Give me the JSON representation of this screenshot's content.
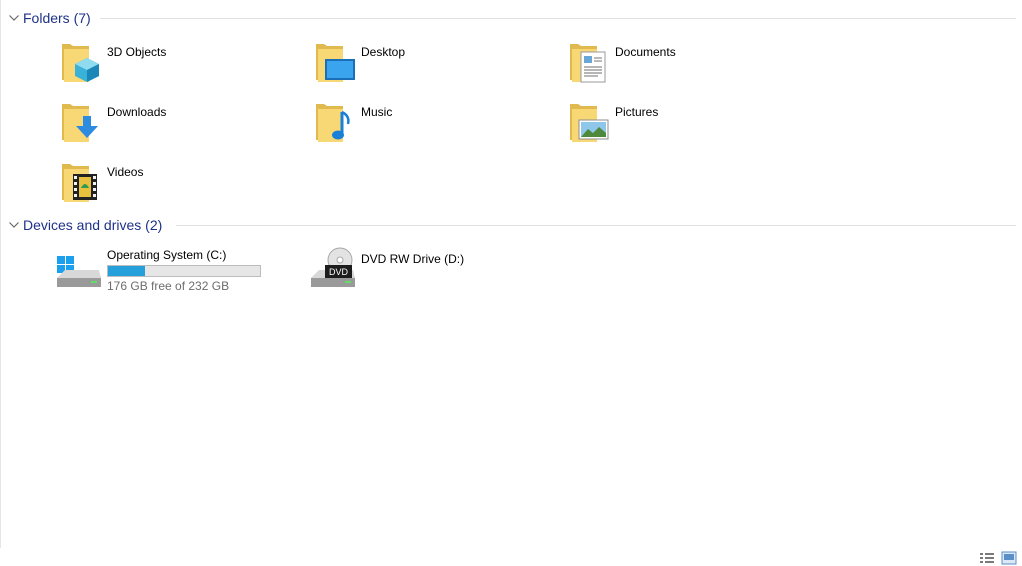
{
  "groups": {
    "folders": {
      "title": "Folders (7)",
      "items": [
        {
          "label": "3D Objects",
          "icon": "3d-objects-folder-icon"
        },
        {
          "label": "Desktop",
          "icon": "desktop-folder-icon"
        },
        {
          "label": "Documents",
          "icon": "documents-folder-icon"
        },
        {
          "label": "Downloads",
          "icon": "downloads-folder-icon"
        },
        {
          "label": "Music",
          "icon": "music-folder-icon"
        },
        {
          "label": "Pictures",
          "icon": "pictures-folder-icon"
        },
        {
          "label": "Videos",
          "icon": "videos-folder-icon"
        }
      ]
    },
    "devices": {
      "title": "Devices and drives (2)",
      "items": [
        {
          "label": "Operating System (C:)",
          "free_text": "176 GB free of 232 GB",
          "used_fraction": 0.241,
          "icon": "windows-drive-icon"
        },
        {
          "label": "DVD RW Drive (D:)",
          "icon": "dvd-drive-icon",
          "badge": "DVD"
        }
      ]
    }
  },
  "statusbar": {
    "details_view_icon": "details-view-icon",
    "large_icons_view_icon": "large-icons-view-icon"
  },
  "colors": {
    "group_title": "#1e3287",
    "progress_fill": "#26a0da",
    "folder": "#f8d775"
  }
}
